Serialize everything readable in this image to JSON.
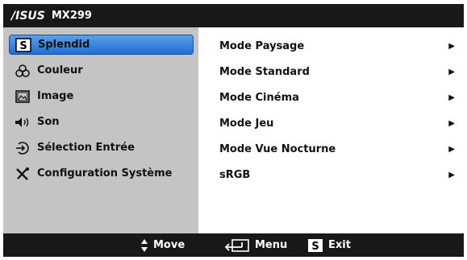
{
  "header": {
    "brand": "/ISUS",
    "model": "MX299"
  },
  "left_menu": {
    "items": [
      {
        "label": "Splendid",
        "icon": "splendid-s-icon",
        "selected": true
      },
      {
        "label": "Couleur",
        "icon": "color-circles-icon",
        "selected": false
      },
      {
        "label": "Image",
        "icon": "image-frame-icon",
        "selected": false
      },
      {
        "label": "Son",
        "icon": "speaker-icon",
        "selected": false
      },
      {
        "label": "Sélection Entrée",
        "icon": "input-arrow-icon",
        "selected": false
      },
      {
        "label": "Configuration Système",
        "icon": "wrench-screwdriver-icon",
        "selected": false
      }
    ]
  },
  "right_menu": {
    "items": [
      {
        "label": "Mode Paysage"
      },
      {
        "label": "Mode Standard"
      },
      {
        "label": "Mode Cinéma"
      },
      {
        "label": "Mode Jeu"
      },
      {
        "label": "Mode Vue Nocturne"
      },
      {
        "label": "sRGB"
      }
    ]
  },
  "footer": {
    "move_label": "Move",
    "menu_label": "Menu",
    "exit_label": "Exit"
  },
  "colors": {
    "selected_item": "#3f8ae0",
    "left_panel": "#c4c4c4",
    "bar": "#181818"
  }
}
